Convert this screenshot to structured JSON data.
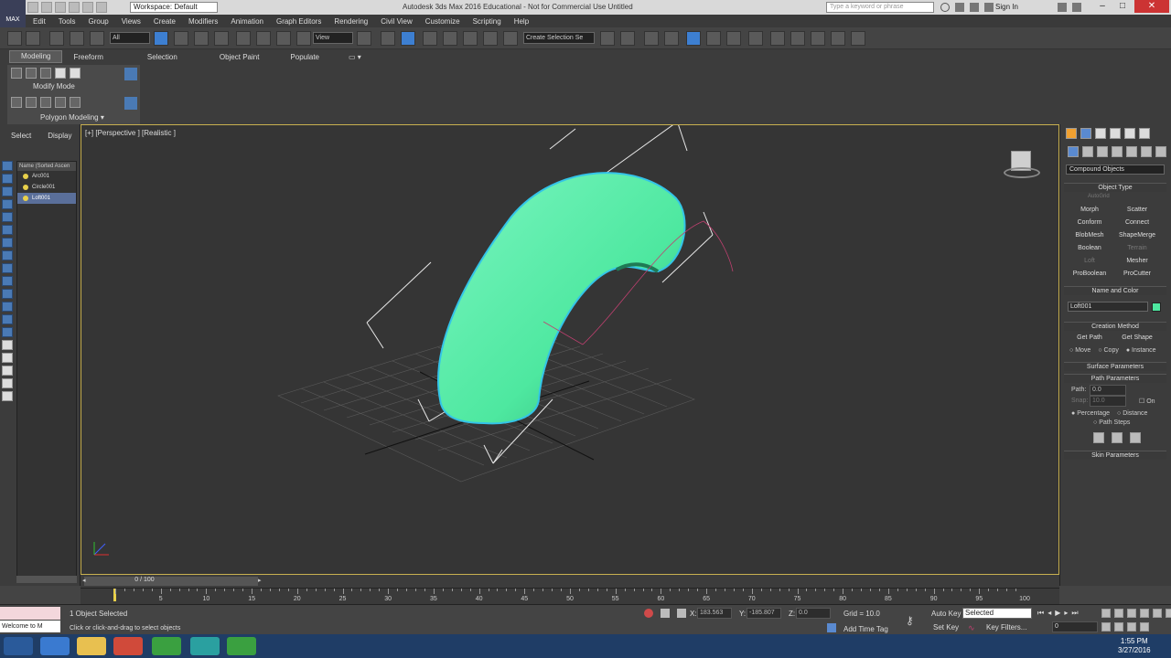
{
  "window": {
    "title": "Autodesk 3ds Max 2016 Educational - Not for Commercial Use   Untitled",
    "workspace": "Workspace: Default",
    "search_placeholder": "Type a keyword or phrase",
    "sign_in": "Sign In",
    "logo": "MAX"
  },
  "menu": [
    "Edit",
    "Tools",
    "Group",
    "Views",
    "Create",
    "Modifiers",
    "Animation",
    "Graph Editors",
    "Rendering",
    "Civil View",
    "Customize",
    "Scripting",
    "Help"
  ],
  "toolbar": {
    "filter": "All",
    "reference": "View",
    "selection_set": "Create Selection Se"
  },
  "ribbon": {
    "tabs": [
      "Modeling",
      "Freeform",
      "Selection",
      "Object Paint",
      "Populate"
    ],
    "modify_mode": "Modify Mode",
    "polygon_modeling": "Polygon Modeling ▾"
  },
  "scene_explorer": {
    "tabs": [
      "Select",
      "Display"
    ],
    "header": "Name (Sorted Ascen",
    "items": [
      "Arc001",
      "Circle001",
      "Loft001"
    ]
  },
  "viewport": {
    "label": "[+] [Perspective ] [Realistic ]"
  },
  "command_panel": {
    "category": "Compound Objects",
    "object_type": {
      "title": "Object Type",
      "autogrid": "AutoGrid",
      "buttons": [
        {
          "label": "Morph",
          "enabled": true
        },
        {
          "label": "Scatter",
          "enabled": true
        },
        {
          "label": "Conform",
          "enabled": true
        },
        {
          "label": "Connect",
          "enabled": true
        },
        {
          "label": "BlobMesh",
          "enabled": true
        },
        {
          "label": "ShapeMerge",
          "enabled": true
        },
        {
          "label": "Boolean",
          "enabled": true
        },
        {
          "label": "Terrain",
          "enabled": false
        },
        {
          "label": "Loft",
          "enabled": false
        },
        {
          "label": "Mesher",
          "enabled": true
        },
        {
          "label": "ProBoolean",
          "enabled": true
        },
        {
          "label": "ProCutter",
          "enabled": true
        }
      ]
    },
    "name_and_color": {
      "title": "Name and Color",
      "name": "Loft001",
      "color": "#4ee8a0"
    },
    "creation_method": {
      "title": "Creation Method",
      "get_path": "Get Path",
      "get_shape": "Get Shape",
      "move": "Move",
      "copy": "Copy",
      "instance": "Instance"
    },
    "surface_parameters": "Surface Parameters",
    "path_parameters": {
      "title": "Path Parameters",
      "path_label": "Path:",
      "path_value": "0.0",
      "snap_label": "Snap:",
      "snap_value": "10.0",
      "on": "On",
      "percentage": "Percentage",
      "distance": "Distance",
      "path_steps": "Path Steps"
    },
    "skin_parameters": "Skin Parameters"
  },
  "timeline": {
    "frame": "0 / 100",
    "ticks": [
      "5",
      "10",
      "15",
      "20",
      "25",
      "30",
      "35",
      "40",
      "45",
      "50",
      "55",
      "60",
      "65",
      "70",
      "75",
      "80",
      "85",
      "90",
      "95",
      "100"
    ]
  },
  "status": {
    "maxscript": "Welcome to M",
    "selected": "1 Object Selected",
    "prompt": "Click or click-and-drag to select objects",
    "x_label": "X:",
    "x_value": "183.563",
    "y_label": "Y:",
    "y_value": "-185.807",
    "z_label": "Z:",
    "z_value": "0.0",
    "grid": "Grid = 10.0",
    "add_time_tag": "Add Time Tag",
    "auto_key": "Auto Key",
    "set_key": "Set Key",
    "selected_set": "Selected",
    "key_filters": "Key Filters...",
    "frame_field": "0"
  },
  "taskbar": {
    "time": "1:55 PM",
    "date": "3/27/2016"
  }
}
